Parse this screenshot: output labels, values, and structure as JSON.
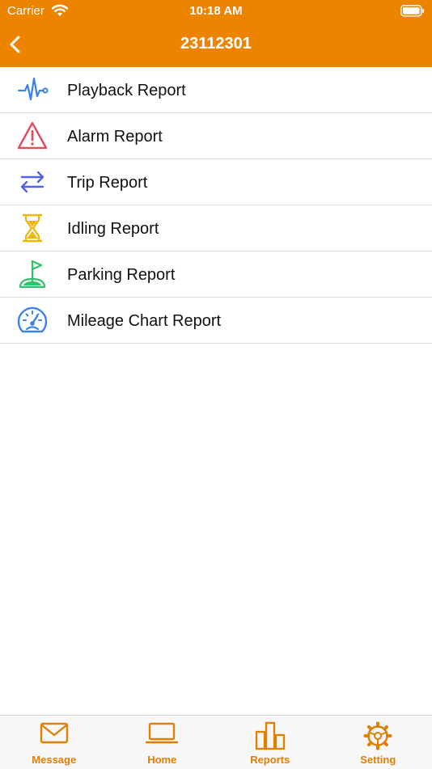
{
  "status_bar": {
    "carrier": "Carrier",
    "time": "10:18 AM"
  },
  "nav": {
    "title": "23112301"
  },
  "reports": [
    {
      "label": "Playback Report",
      "icon": "pulse-icon",
      "color": "#3b82e8"
    },
    {
      "label": "Alarm Report",
      "icon": "warning-triangle-icon",
      "color": "#e24d5c"
    },
    {
      "label": "Trip Report",
      "icon": "swap-arrows-icon",
      "color": "#5560e6"
    },
    {
      "label": "Idling Report",
      "icon": "hourglass-icon",
      "color": "#f2b705"
    },
    {
      "label": "Parking Report",
      "icon": "flag-icon",
      "color": "#2ec26a"
    },
    {
      "label": "Mileage Chart Report",
      "icon": "speedometer-icon",
      "color": "#3b82e8"
    }
  ],
  "tabs": [
    {
      "label": "Message",
      "icon": "envelope-icon"
    },
    {
      "label": "Home",
      "icon": "laptop-icon"
    },
    {
      "label": "Reports",
      "icon": "bar-chart-icon"
    },
    {
      "label": "Setting",
      "icon": "gear-icon"
    }
  ],
  "colors": {
    "brand": "#ec8400",
    "tab_tint": "#e07f00",
    "separator": "#dcdcdc"
  }
}
